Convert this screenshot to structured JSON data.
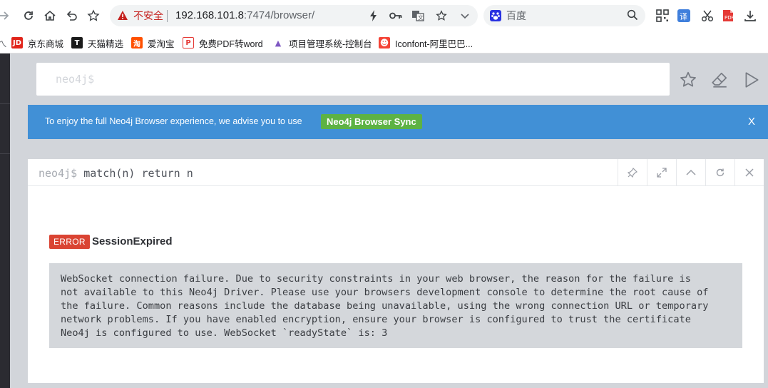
{
  "browser": {
    "insecure_label": "不安全",
    "url_host": "192.168.101.8",
    "url_path": ":7474/browser/",
    "search_placeholder": "百度",
    "icons": [
      "forward-icon",
      "reload-icon",
      "home-icon",
      "undo-icon",
      "bookmark-star-icon",
      "warning-icon",
      "lightning-icon",
      "key-icon",
      "translate-icon",
      "star-icon",
      "chevron-down-icon",
      "baidu-icon",
      "search-icon",
      "qrcode-icon",
      "translate-ext-icon",
      "scissors-icon",
      "pdf-icon",
      "download-icon"
    ]
  },
  "bookmarks": [
    {
      "label": "京东商城",
      "icon": "jd-icon",
      "color": "#e1251b",
      "glyph": "JD"
    },
    {
      "label": "天猫精选",
      "icon": "tmall-icon",
      "color": "#1a1a1a",
      "glyph": "T"
    },
    {
      "label": "爱淘宝",
      "icon": "taobao-icon",
      "color": "#ff5000",
      "glyph": "淘"
    },
    {
      "label": "免费PDF转word",
      "icon": "pdf-icon",
      "color": "#e53935",
      "glyph": "P"
    },
    {
      "label": "项目管理系统-控制台",
      "icon": "project-icon",
      "color": "#7e57c2",
      "glyph": "▲"
    },
    {
      "label": "Iconfont-阿里巴巴...",
      "icon": "iconfont-icon",
      "color": "#f44336",
      "glyph": "☻"
    }
  ],
  "editor": {
    "prompt": "neo4j$"
  },
  "banner": {
    "text": "To enjoy the full Neo4j Browser experience, we advise you to use",
    "button_label": "Neo4j Browser Sync",
    "close_label": "X"
  },
  "frame": {
    "prompt": "neo4j$",
    "command": "match(n) return n",
    "error_badge": "ERROR",
    "error_title": "SessionExpired",
    "error_message": "WebSocket connection failure. Due to security constraints in your web browser, the reason for the failure is\nnot available to this Neo4j Driver. Please use your browsers development console to determine the root cause of\nthe failure. Common reasons include the database being unavailable, using the wrong connection URL or temporary\nnetwork problems. If you have enabled encryption, ensure your browser is configured to trust the certificate\nNeo4j is configured to use. WebSocket `readyState` is: 3"
  },
  "colors": {
    "banner": "#4190d6",
    "sync_button": "#5db244",
    "error_badge": "#da4433"
  }
}
